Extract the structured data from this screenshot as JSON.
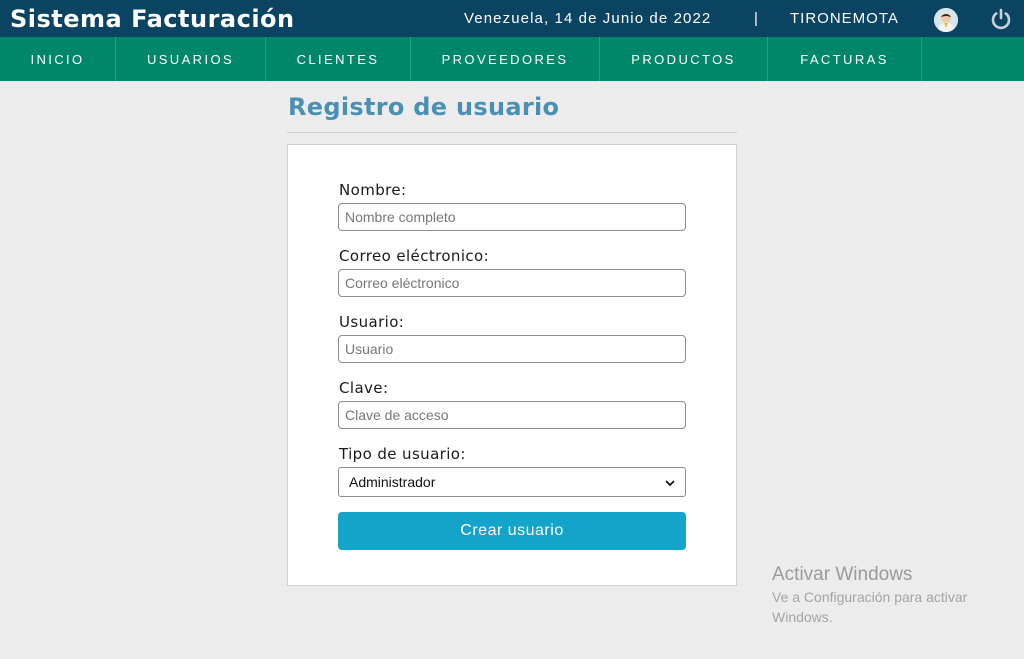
{
  "app": {
    "title": "Sistema Facturación"
  },
  "header": {
    "date": "Venezuela, 14 de Junio de 2022",
    "separator": "|",
    "username": "TIRONEMOTA",
    "avatar_icon": "user-avatar-icon",
    "power_icon": "power-icon"
  },
  "nav": {
    "items": [
      {
        "label": "INICIO"
      },
      {
        "label": "USUARIOS"
      },
      {
        "label": "CLIENTES"
      },
      {
        "label": "PROVEEDORES"
      },
      {
        "label": "PRODUCTOS"
      },
      {
        "label": "FACTURAS"
      }
    ]
  },
  "page": {
    "title": "Registro de usuario"
  },
  "form": {
    "nombre": {
      "label": "Nombre:",
      "placeholder": "Nombre completo",
      "value": ""
    },
    "correo": {
      "label": "Correo eléctronico:",
      "placeholder": "Correo eléctronico",
      "value": ""
    },
    "usuario": {
      "label": "Usuario:",
      "placeholder": "Usuario",
      "value": ""
    },
    "clave": {
      "label": "Clave:",
      "placeholder": "Clave de acceso",
      "value": ""
    },
    "tipo": {
      "label": "Tipo de usuario:",
      "selected": "Administrador"
    },
    "submit_label": "Crear usuario"
  },
  "watermark": {
    "title": "Activar Windows",
    "line1": "Ve a Configuración para activar",
    "line2": "Windows."
  },
  "colors": {
    "topbar": "#0b4462",
    "navbar": "#00876a",
    "title": "#4a90b3",
    "button": "#14a4c9",
    "background": "#ececec"
  }
}
